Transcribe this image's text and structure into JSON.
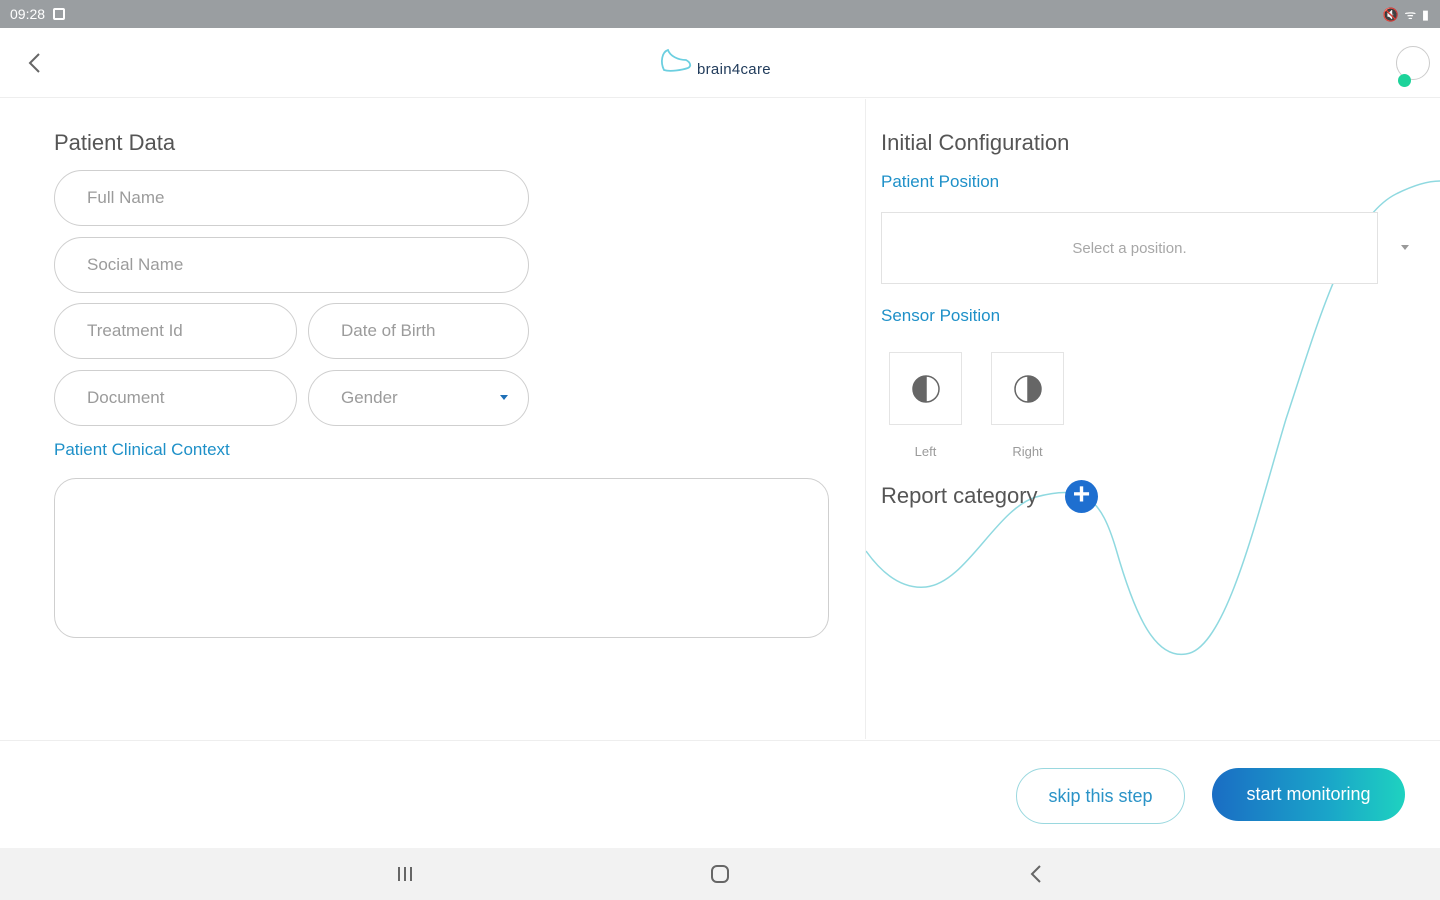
{
  "status_bar": {
    "time": "09:28",
    "system_icons": "🔇 ᯤ ▮"
  },
  "header": {
    "logo_text": "brain4care"
  },
  "patient_data": {
    "title": "Patient Data",
    "full_name_placeholder": "Full Name",
    "social_name_placeholder": "Social Name",
    "treatment_id_placeholder": "Treatment Id",
    "date_of_birth_placeholder": "Date of Birth",
    "document_placeholder": "Document",
    "gender_label": "Gender",
    "clinical_context_label": "Patient Clinical Context",
    "clinical_context_value": ""
  },
  "initial_configuration": {
    "title": "Initial Configuration",
    "patient_position_label": "Patient Position",
    "position_placeholder": "Select a position.",
    "sensor_position_label": "Sensor Position",
    "sensor_left_label": "Left",
    "sensor_right_label": "Right",
    "report_category_label": "Report category",
    "add_icon": "+"
  },
  "footer": {
    "skip_label": "skip this step",
    "start_label": "start monitoring"
  },
  "colors": {
    "accent_blue": "#1e90c8",
    "online": "#1dd39a",
    "wave": "#8fd9e0"
  },
  "icons": [
    "back-icon",
    "logo-icon",
    "user-avatar-icon",
    "caret-down-icon",
    "sensor-left-icon",
    "sensor-right-icon",
    "plus-icon",
    "recent-apps-icon",
    "home-icon",
    "nav-back-icon"
  ]
}
